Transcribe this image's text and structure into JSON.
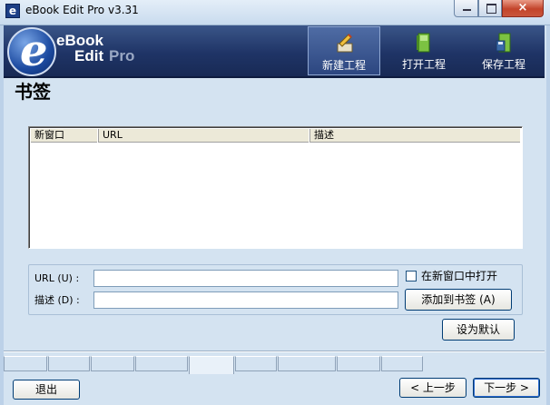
{
  "window": {
    "icon_letter": "e",
    "title": "eBook Edit Pro v3.31",
    "close_glyph": "×"
  },
  "brand": {
    "logo_letter": "e",
    "word_ebook": "eBook",
    "word_edit": "Edit",
    "word_pro": "Pro"
  },
  "toolbar": {
    "new_project": "新建工程",
    "open_project": "打开工程",
    "save_project": "保存工程"
  },
  "page": {
    "title": "书签"
  },
  "bookmarks_table": {
    "columns": [
      "新窗口",
      "URL",
      "描述"
    ],
    "rows": []
  },
  "form": {
    "url_label": "URL (U) :",
    "url_value": "",
    "desc_label": "描述 (D) :",
    "desc_value": "",
    "open_new_window_label": "在新窗口中打开",
    "open_new_window_checked": false,
    "add_bookmark_button": "添加到书签 (A)",
    "set_default_button": "设为默认"
  },
  "footer": {
    "exit_button": "退出",
    "prev_button": "< 上一步",
    "next_button": "下一步 >"
  },
  "colors": {
    "brand_dark": "#1f3466",
    "dialog_bg": "#d4e3f1",
    "close_red": "#c3442b"
  }
}
